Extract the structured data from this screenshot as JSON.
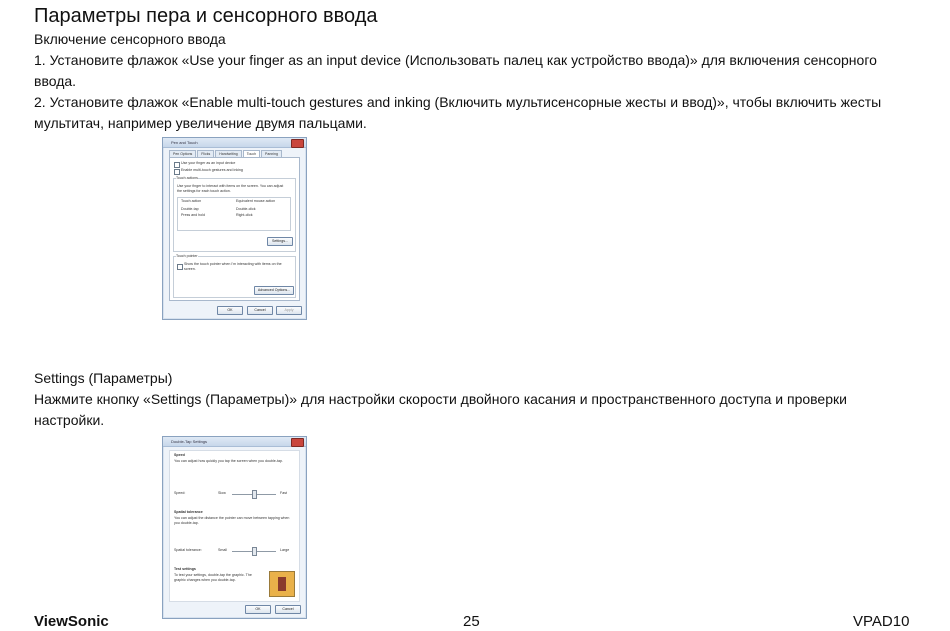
{
  "page": {
    "title": "Параметры пера и сенсорного ввода",
    "section1_heading": "Включение сенсорного ввода",
    "step1": "1. Установите флажок «Use your finger as an input device (Использовать палец как устройство ввода)» для включения сенсорного ввода.",
    "step2": "2. Установите флажок «Enable multi-touch gestures and inking (Включить мультисенсорные жесты и ввод)», чтобы включить жесты мультитач, например увеличение двумя пальцами.",
    "section2_heading": "Settings (Параметры)",
    "section2_text": "Нажмите кнопку «Settings (Параметры)» для настройки скорости двойного касания и пространственного доступа и проверки настройки."
  },
  "dialog1": {
    "title": "Pen and Touch",
    "tabs": [
      "Pen Options",
      "Flicks",
      "Handwriting",
      "Touch",
      "Panning"
    ],
    "check1": "Use your finger as an input device",
    "check2": "Enable multi-touch gestures and inking",
    "group_title": "Touch actions",
    "group_desc": "Use your finger to interact with items on the screen. You can adjust the settings for each touch action.",
    "col1": "Touch action",
    "col2": "Equivalent mouse action",
    "row1a": "Double-tap",
    "row1b": "Double-click",
    "row2a": "Press and hold",
    "row2b": "Right-click",
    "settings_btn": "Settings...",
    "pointer_title": "Touch pointer",
    "pointer_check": "Show the touch pointer when I'm interacting with items on the screen.",
    "advanced_btn": "Advanced Options...",
    "ok": "OK",
    "cancel": "Cancel",
    "apply": "Apply"
  },
  "dialog2": {
    "title": "Double-Tap Settings",
    "speed_title": "Speed",
    "speed_desc": "You can adjust how quickly you tap the screen when you double-tap.",
    "speed_label": "Speed:",
    "slow": "Slow",
    "fast": "Fast",
    "spatial_title": "Spatial tolerance",
    "spatial_desc": "You can adjust the distance the pointer can move between tapping when you double-tap.",
    "spatial_label": "Spatial tolerance:",
    "small": "Small",
    "large": "Large",
    "test_title": "Test settings",
    "test_desc": "To test your settings, double-tap the graphic. The graphic changes when you double-tap.",
    "ok": "OK",
    "cancel": "Cancel"
  },
  "footer": {
    "brand": "ViewSonic",
    "page_number": "25",
    "model": "VPAD10"
  }
}
